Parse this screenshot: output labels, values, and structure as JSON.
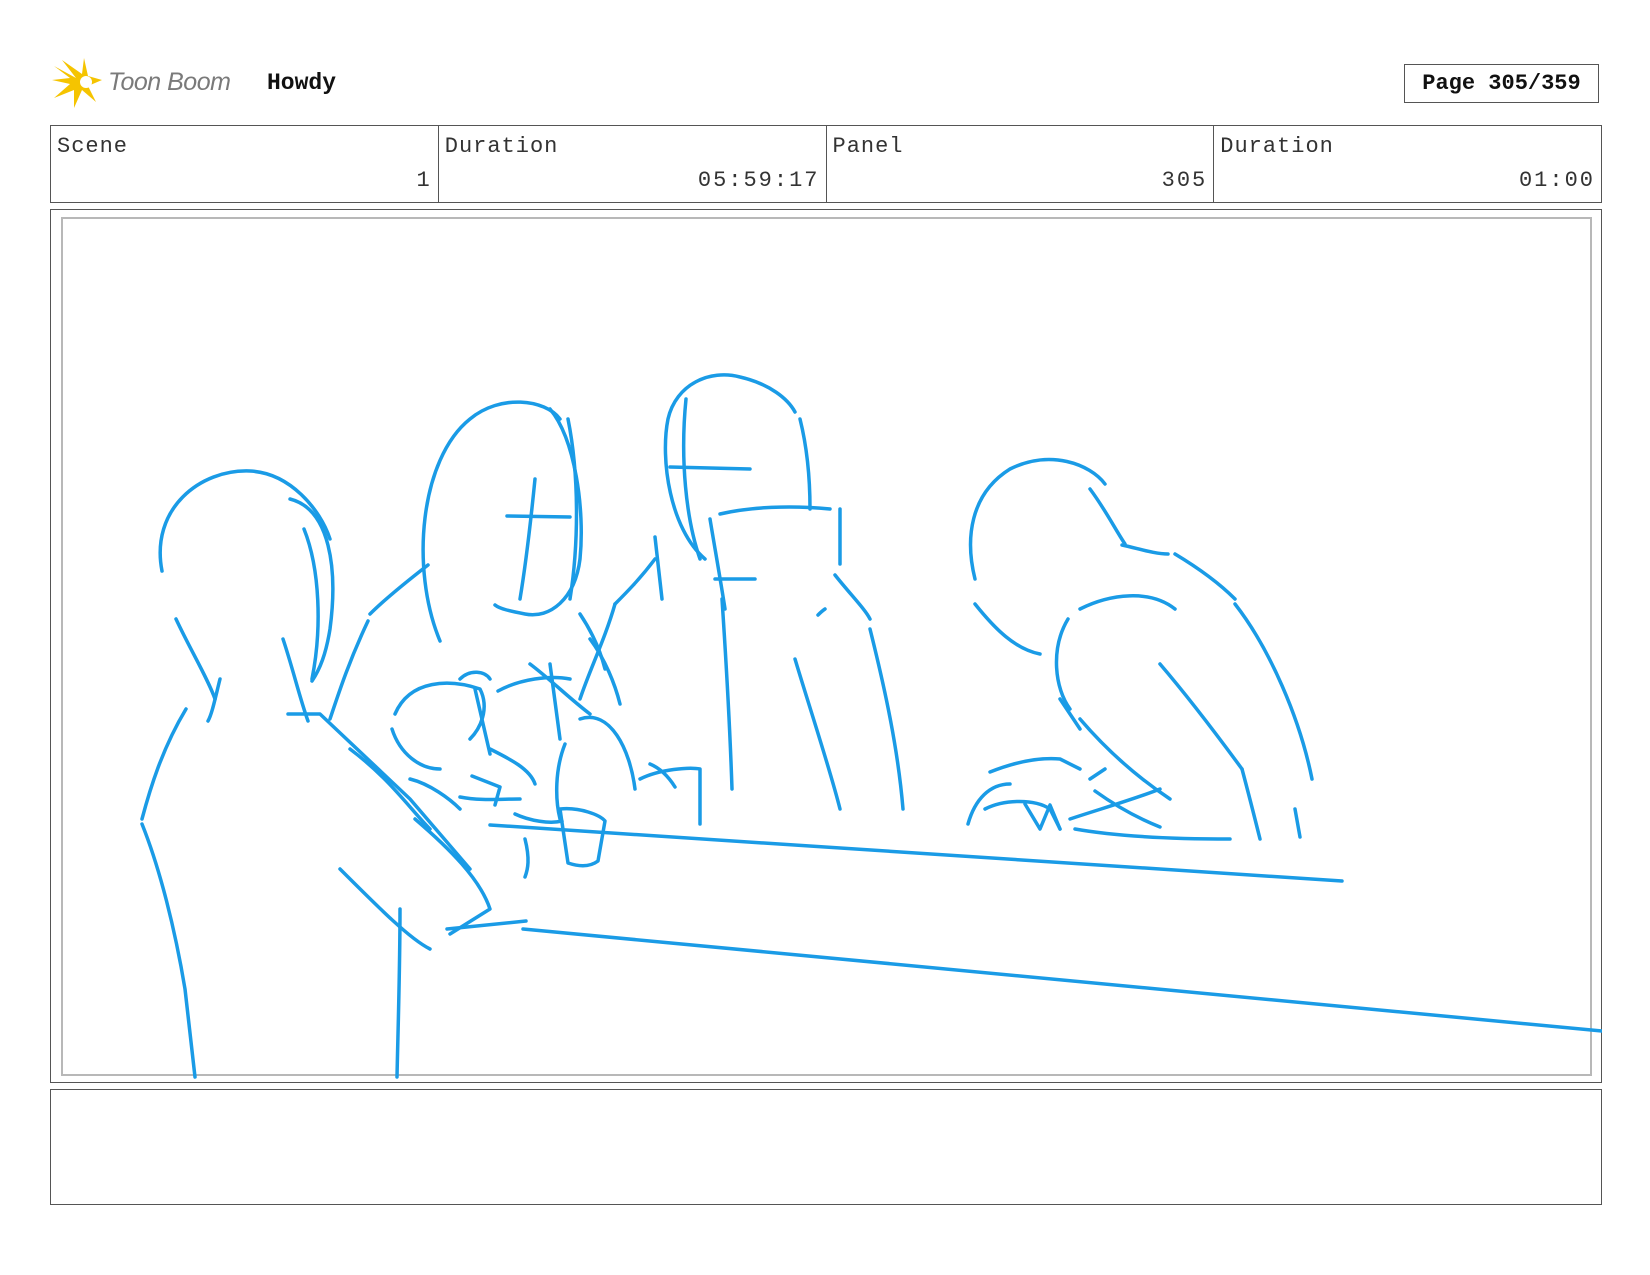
{
  "header": {
    "logo_text": "Toon Boom",
    "project_title": "Howdy",
    "page_label": "Page 305/359"
  },
  "info": {
    "scene_label": "Scene",
    "scene_value": "1",
    "scene_duration_label": "Duration",
    "scene_duration_value": "05:59:17",
    "panel_label": "Panel",
    "panel_value": "305",
    "panel_duration_label": "Duration",
    "panel_duration_value": "01:00"
  },
  "colors": {
    "sketch": "#1a9be6",
    "logo_accent": "#f5c400"
  },
  "notes": {
    "text": ""
  }
}
